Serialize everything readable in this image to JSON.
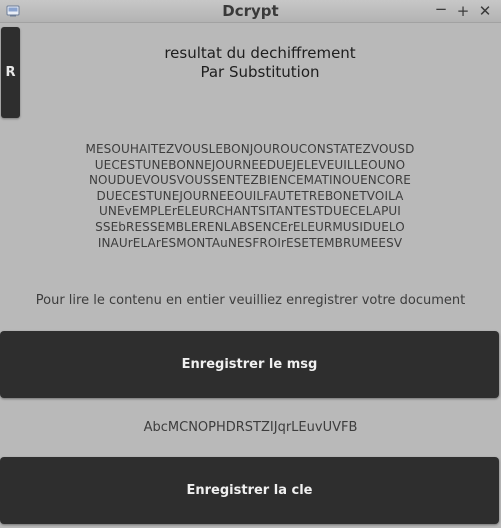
{
  "window": {
    "title": "Dcrypt",
    "controls": {
      "minimize": "−",
      "maximize": "+",
      "close": "✕"
    }
  },
  "sidebar": {
    "r_button_label": "R"
  },
  "result": {
    "title_line1": "resultat du dechiffrement",
    "title_line2": "Par Substitution"
  },
  "ciphertext_lines": [
    "MESOUHAITEZVOUSLEBONJOUROUCONSTATEZVOUSD",
    "UECESTUNEBONNEJOURNEEDUEJELEVEUILLEOUNO",
    "NOUDUEVOUSVOUSSENTEZBIENCEMATINOUENCORE",
    "DUECESTUNEJOURNEEOUILFAUTETREBONETVOILA",
    "UNEvEMPLErELEURCHANTSITANTESTDUECELAPUI",
    "SSEbRESSEMBLERENLABSENCErELEURMUSIDUELO",
    "INAUrELArESMONTAuNESFROIrESETEMBRUMEESV"
  ],
  "info_text": "Pour lire le contenu en entier veuilliez enregistrer votre document",
  "buttons": {
    "save_msg": "Enregistrer le msg",
    "save_key": "Enregistrer la cle"
  },
  "key": "AbcMCNOPHDRSTZIJqrLEuvUVFB"
}
